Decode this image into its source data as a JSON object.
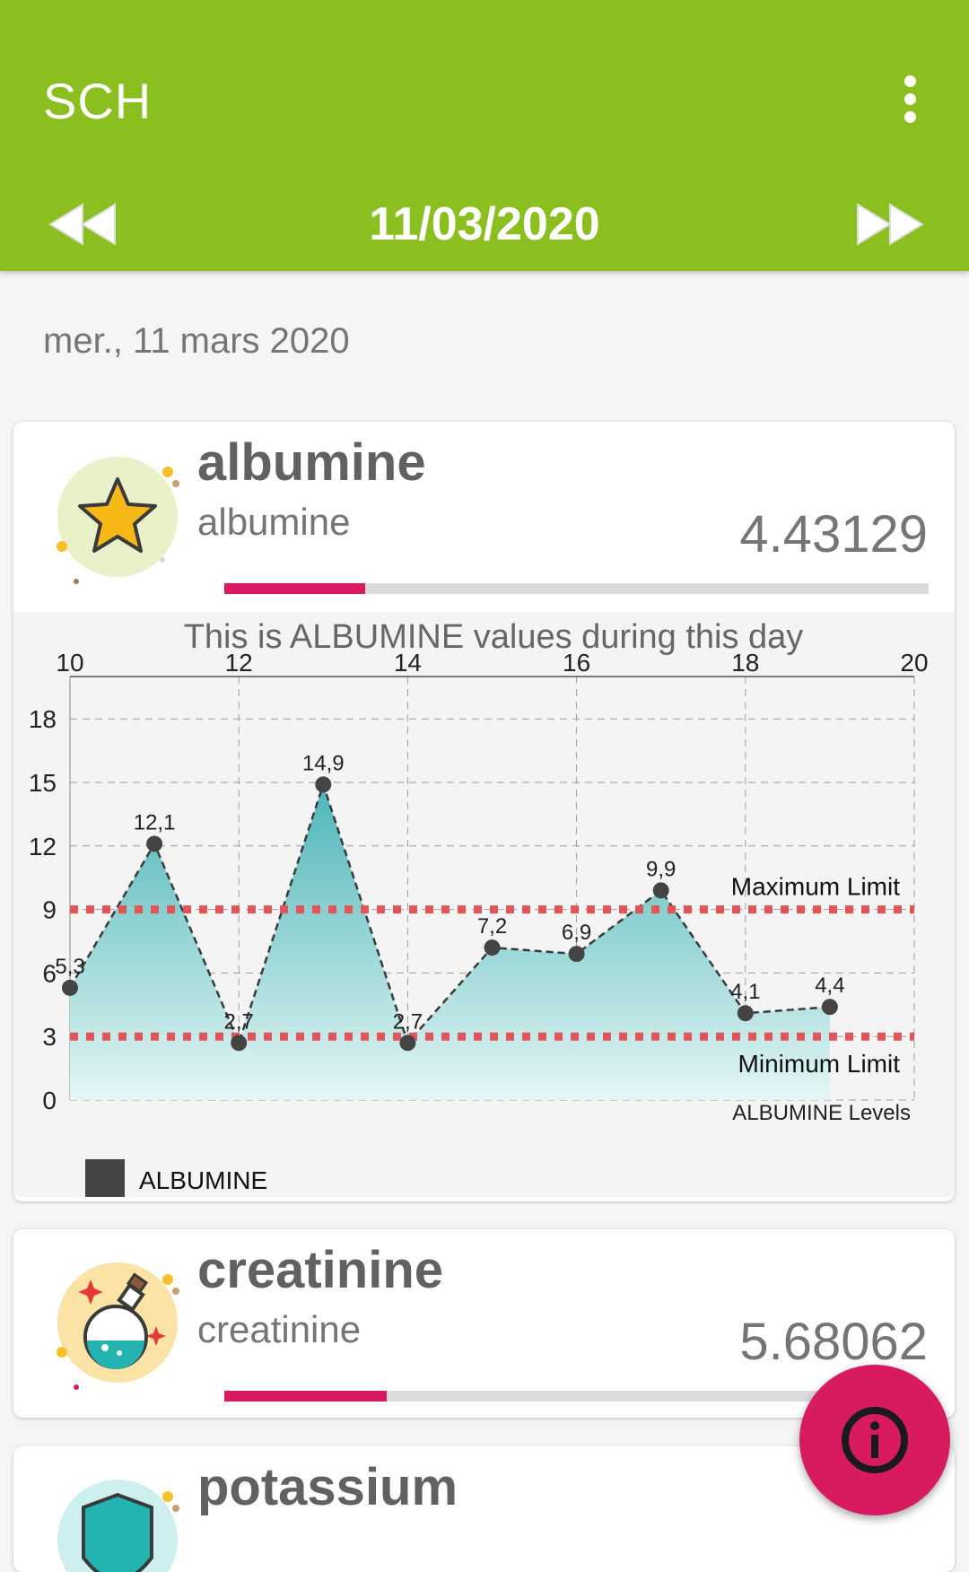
{
  "app": {
    "title": "SCH",
    "menu_icon": "more-vert-icon",
    "prev_icon": "fast-rewind-icon",
    "next_icon": "fast-forward-icon",
    "current_date": "11/03/2020",
    "date_long": "mer., 11 mars 2020",
    "accent_color": "#8bbf1f",
    "progress_color": "#d81b60"
  },
  "cards": [
    {
      "title": "albumine",
      "subtitle": "albumine",
      "value": "4.43129",
      "progress": 0.2,
      "icon": "star-icon"
    },
    {
      "title": "creatinine",
      "subtitle": "creatinine",
      "value": "5.68062",
      "progress": 0.23,
      "icon": "potion-icon"
    },
    {
      "title": "potassium",
      "icon": "shield-icon"
    }
  ],
  "chart_data": {
    "type": "area",
    "title": "This is ALBUMINE values during this day",
    "description": "ALBUMINE Levels",
    "legend": [
      "ALBUMINE"
    ],
    "legend_placement": "bottom-left",
    "x_axis_position": "top",
    "grid": true,
    "xlim": [
      10,
      20
    ],
    "ylim": [
      0,
      20
    ],
    "x_ticks": [
      "10",
      "12",
      "14",
      "16",
      "18",
      "20"
    ],
    "y_ticks": [
      "0",
      "3",
      "6",
      "9",
      "12",
      "15",
      "18"
    ],
    "series": [
      {
        "name": "ALBUMINE",
        "x": [
          10,
          11,
          12,
          13,
          14,
          15,
          16,
          17,
          18,
          19
        ],
        "y": [
          5.3,
          12.1,
          2.7,
          14.9,
          2.7,
          7.2,
          6.9,
          9.9,
          4.1,
          4.4
        ],
        "labels": [
          "5,3",
          "12,1",
          "2,7",
          "14,9",
          "2,7",
          "7,2",
          "6,9",
          "9,9",
          "4,1",
          "4,4"
        ]
      }
    ],
    "limits": [
      {
        "label": "Maximum Limit",
        "value": 9
      },
      {
        "label": "Minimum Limit",
        "value": 3
      }
    ]
  },
  "fab": {
    "icon": "info-icon"
  }
}
